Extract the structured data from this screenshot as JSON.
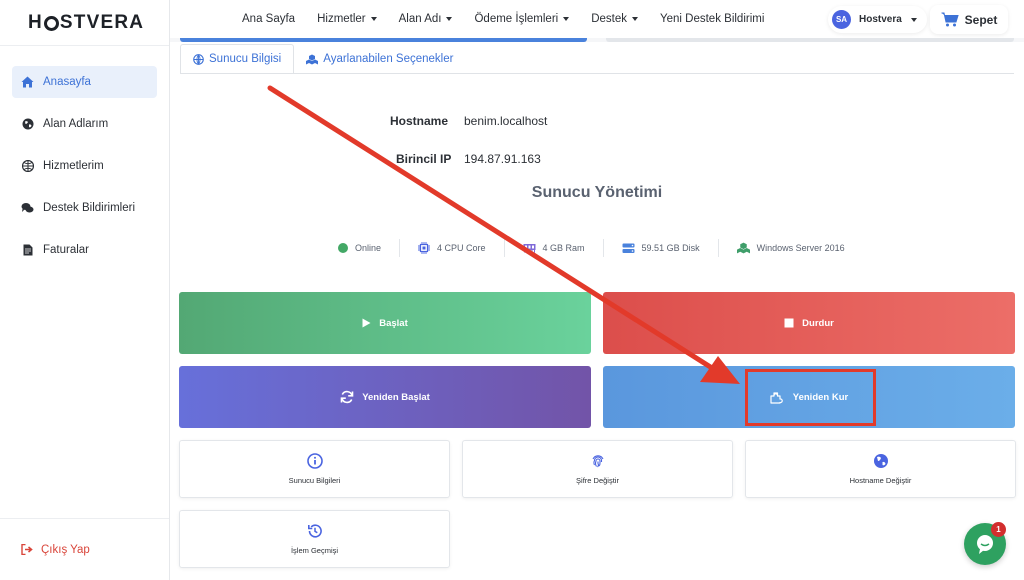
{
  "brand": {
    "logo_pre": "H",
    "logo_post": "STVERA"
  },
  "sidebar": {
    "items": [
      {
        "label": "Anasayfa",
        "icon": "home-icon",
        "active": true
      },
      {
        "label": "Alan Adlarım",
        "icon": "globe-icon"
      },
      {
        "label": "Hizmetlerim",
        "icon": "cubes-icon"
      },
      {
        "label": "Destek Bildirimleri",
        "icon": "comments-icon"
      },
      {
        "label": "Faturalar",
        "icon": "invoice-icon"
      }
    ],
    "logout": "Çıkış Yap"
  },
  "topnav": {
    "items": [
      "Ana Sayfa",
      "Hizmetler",
      "Alan Adı",
      "Ödeme İşlemleri",
      "Destek",
      "Yeni Destek Bildirimi"
    ],
    "user_initials": "SA",
    "user_name": "Hostvera",
    "cart_label": "Sepet"
  },
  "tabs": [
    "Sunucu Bilgisi",
    "Ayarlanabilen Seçenekler"
  ],
  "server": {
    "hostname_label": "Hostname",
    "hostname": "benim.localhost",
    "ip_label": "Birincil IP",
    "ip": "194.87.91.163",
    "section_title": "Sunucu Yönetimi",
    "status": "Online",
    "cpu": "4 CPU Core",
    "ram": "4 GB Ram",
    "disk": "59.51 GB Disk",
    "os": "Windows Server 2016"
  },
  "actions": {
    "start": "Başlat",
    "stop": "Durdur",
    "restart": "Yeniden Başlat",
    "reinstall": "Yeniden Kur"
  },
  "tools": {
    "info": "Sunucu Bilgileri",
    "password": "Şifre Değiştir",
    "hostname": "Hostname Değiştir",
    "history": "İşlem Geçmişi"
  },
  "chat": {
    "badge": "1"
  },
  "colors": {
    "accent": "#3d72d6",
    "start": "#53a874",
    "stop": "#dc4e4b",
    "restart": "#6770da",
    "reinstall": "#5a97dd",
    "highlight": "#e23a2a"
  }
}
